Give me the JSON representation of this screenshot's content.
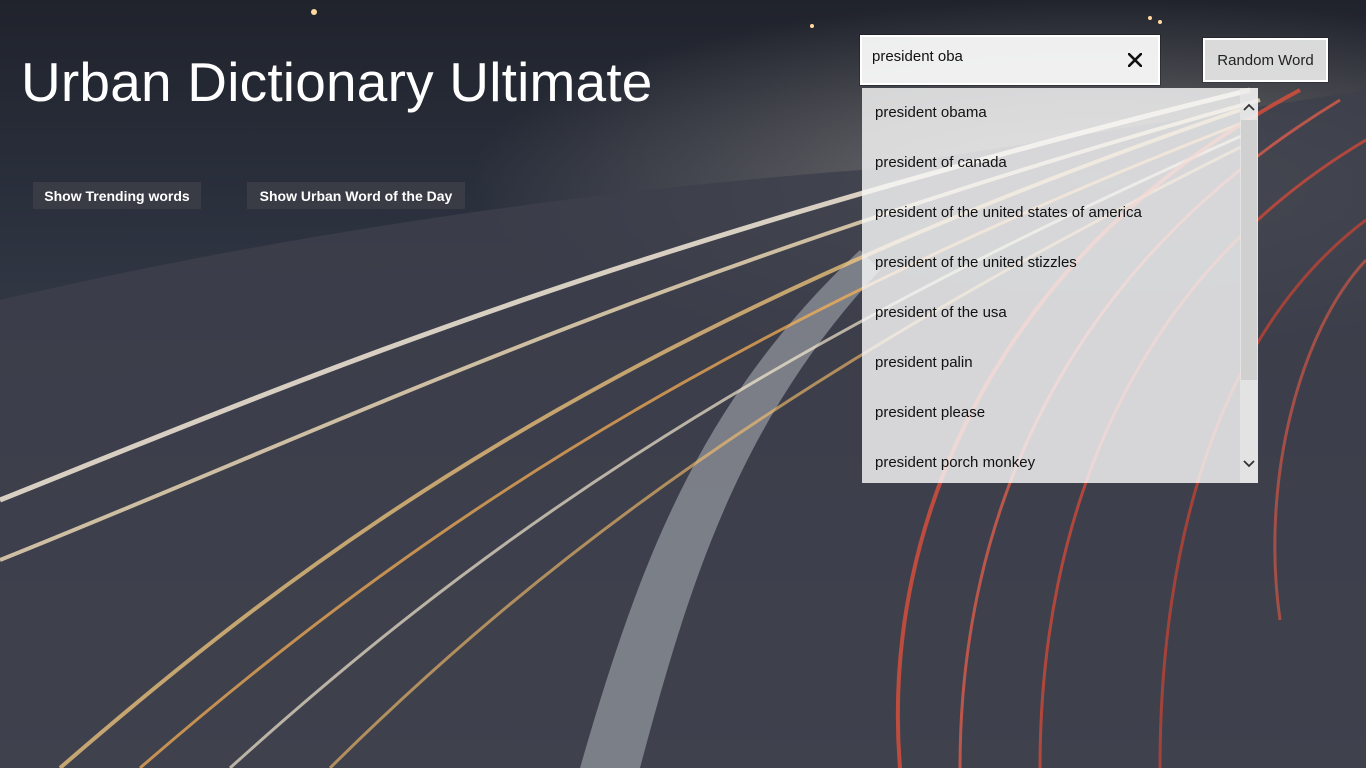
{
  "app": {
    "title": "Urban Dictionary Ultimate"
  },
  "actions": {
    "trending_label": "Show Trending words",
    "word_of_day_label": "Show Urban Word of the Day",
    "random_label": "Random Word"
  },
  "search": {
    "value": "president oba",
    "clear_icon": "close-icon"
  },
  "suggestions": [
    "president obama",
    "president of canada",
    "president of the united states of america",
    "president of the united stizzles",
    "president of the usa",
    "president palin",
    "president please",
    "president porch monkey"
  ],
  "colors": {
    "text_light": "#ffffff",
    "dropdown_bg": "#f8f8f8",
    "button_dark": "#3c3e46"
  }
}
